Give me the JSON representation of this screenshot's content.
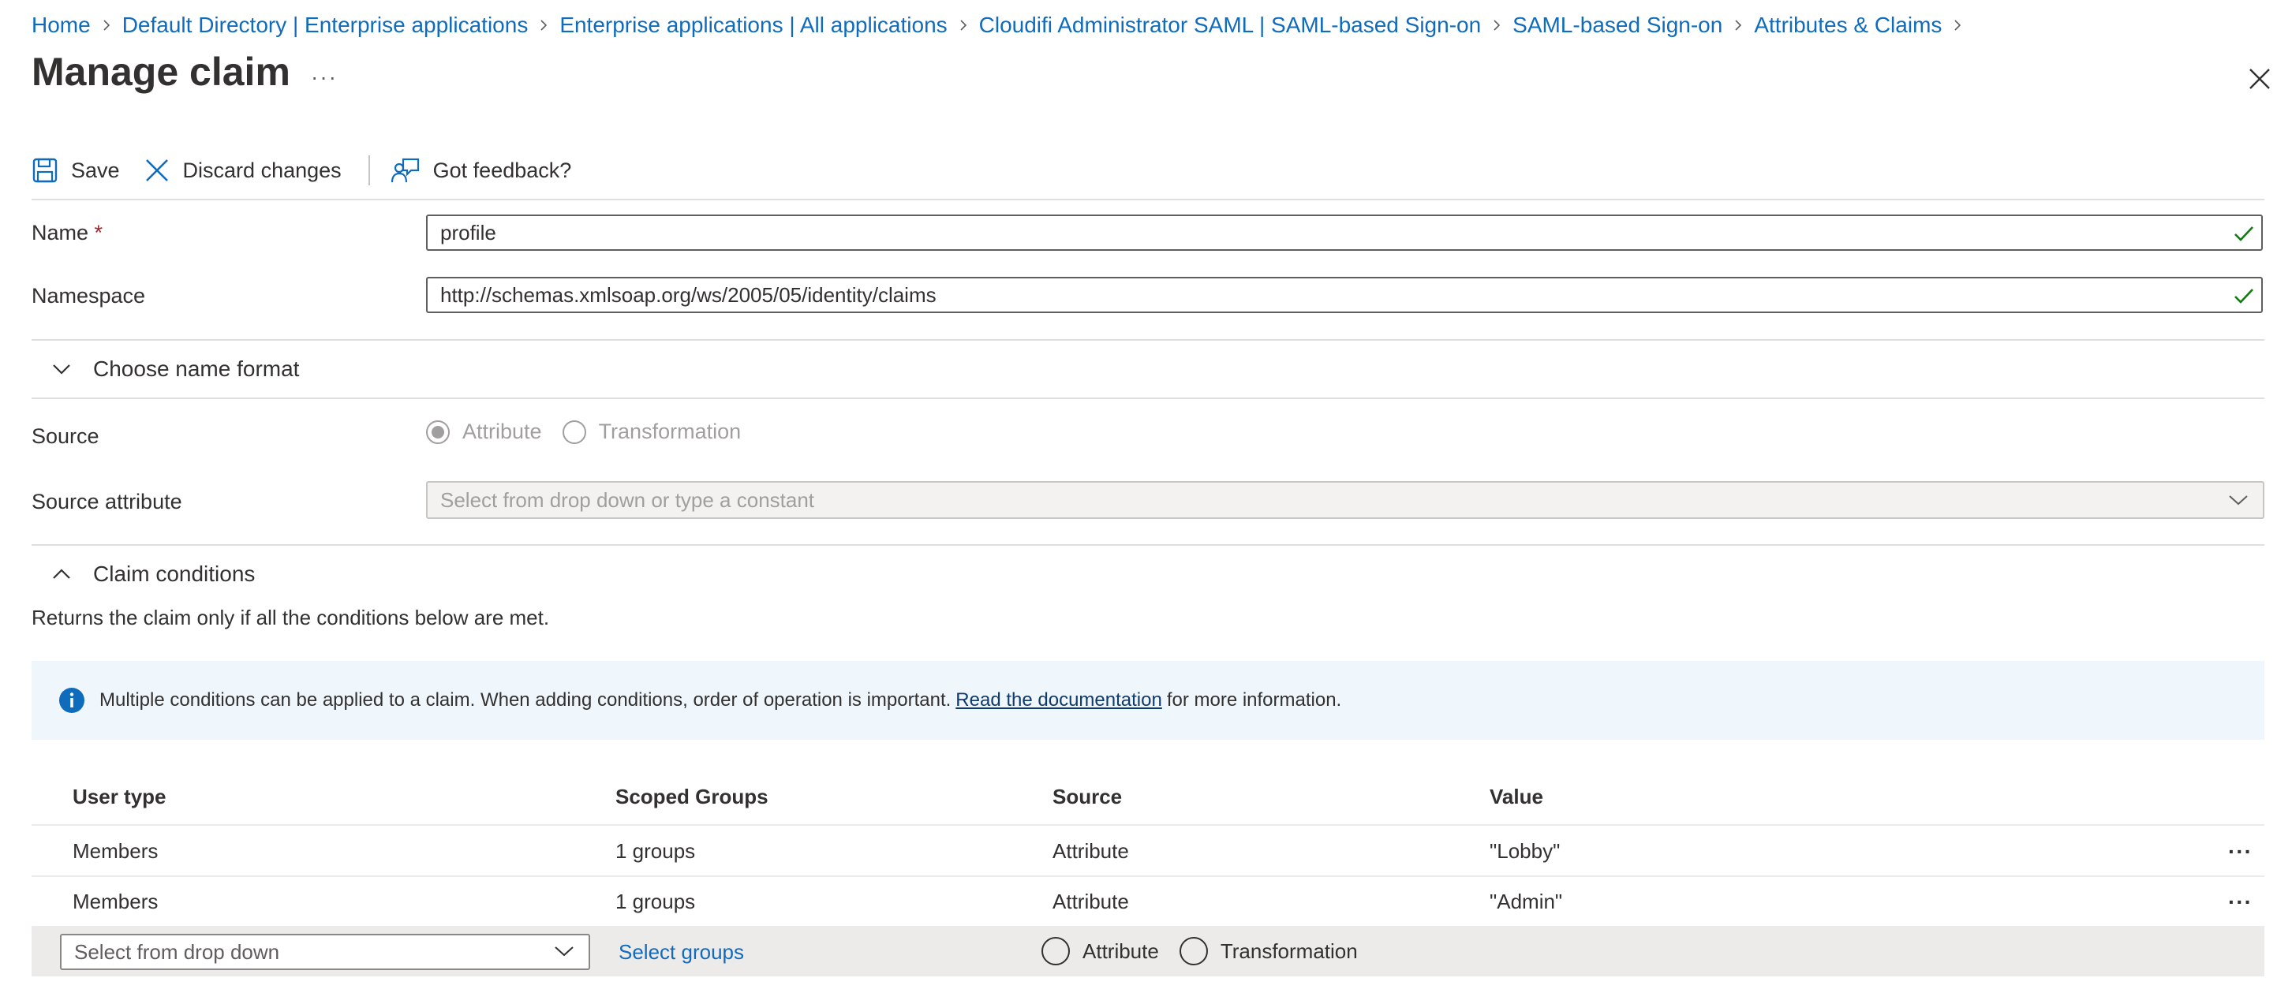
{
  "breadcrumb": {
    "items": [
      "Home",
      "Default Directory | Enterprise applications",
      "Enterprise applications | All applications",
      "Cloudifi Administrator SAML | SAML-based Sign-on",
      "SAML-based Sign-on",
      "Attributes & Claims"
    ]
  },
  "page": {
    "title": "Manage claim",
    "more": "···"
  },
  "toolbar": {
    "save": "Save",
    "discard": "Discard changes",
    "feedback": "Got feedback?"
  },
  "form": {
    "name_label": "Name",
    "required_mark": "*",
    "name_value": "profile",
    "namespace_label": "Namespace",
    "namespace_value": "http://schemas.xmlsoap.org/ws/2005/05/identity/claims",
    "name_format_toggle": "Choose name format",
    "source_label": "Source",
    "source_options": [
      "Attribute",
      "Transformation"
    ],
    "source_selected": "Attribute",
    "source_attribute_label": "Source attribute",
    "source_attribute_placeholder": "Select from drop down or type a constant"
  },
  "conditions": {
    "toggle": "Claim conditions",
    "helper": "Returns the claim only if all the conditions below are met.",
    "info_before": "Multiple conditions can be applied to a claim.  When adding conditions, order of operation is important.",
    "info_link": "Read the documentation",
    "info_after": "for more information.",
    "columns": [
      "User type",
      "Scoped Groups",
      "Source",
      "Value"
    ],
    "rows": [
      {
        "user_type": "Members",
        "groups": "1 groups",
        "source": "Attribute",
        "value": "\"Lobby\""
      },
      {
        "user_type": "Members",
        "groups": "1 groups",
        "source": "Attribute",
        "value": "\"Admin\""
      }
    ],
    "row_more": "···",
    "new_row": {
      "dropdown_placeholder": "Select from drop down",
      "select_groups": "Select groups",
      "source_options": [
        "Attribute",
        "Transformation"
      ]
    }
  },
  "colors": {
    "link": "#0f6cbd",
    "success": "#107c10",
    "info_bg": "#eff6fc"
  }
}
